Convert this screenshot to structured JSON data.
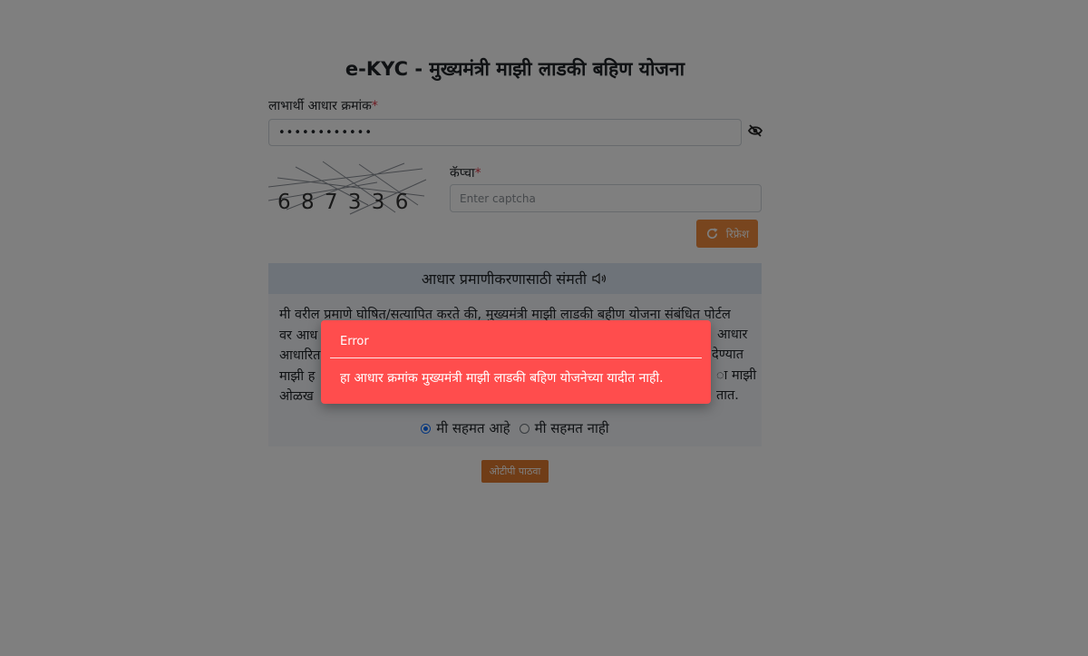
{
  "form": {
    "title": "e-KYC - मुख्यमंत्री माझी लाडकी बहिण योजना",
    "aadhaar_label": "लाभार्थी आधार क्रमांक",
    "required_mark": "*",
    "aadhaar_value": "••••••••••••",
    "captcha_label": "कॅप्चा",
    "captcha_placeholder": "Enter captcha",
    "captcha_code": "6 8 7 3 3 6",
    "refresh_label": "रिफ्रेश"
  },
  "consent": {
    "heading": "आधार प्रमाणीकरणासाठी संमती",
    "lines": [
      "मी वरील प्रमाणे घोषित/सत्यापित करते की, मुख्यमंत्री माझी लाडकी बहीण योजना संबंधित पोर्टल",
      "वर आध",
      "आधारित",
      "माझी ह",
      "ओळख"
    ],
    "right_fragments": [
      "आधार",
      "देण्यात",
      "ा माझी",
      "तात."
    ],
    "agree_label": "मी सहमत आहे",
    "disagree_label": "मी सहमत नाही",
    "selected": "agree"
  },
  "actions": {
    "send_otp_label": "ओटीपी पाठवा"
  },
  "error_dialog": {
    "title": "Error",
    "message": "हा आधार क्रमांक मुख्यमंत्री माझी लाडकी बहिण योजनेच्या यादीत नाही."
  }
}
